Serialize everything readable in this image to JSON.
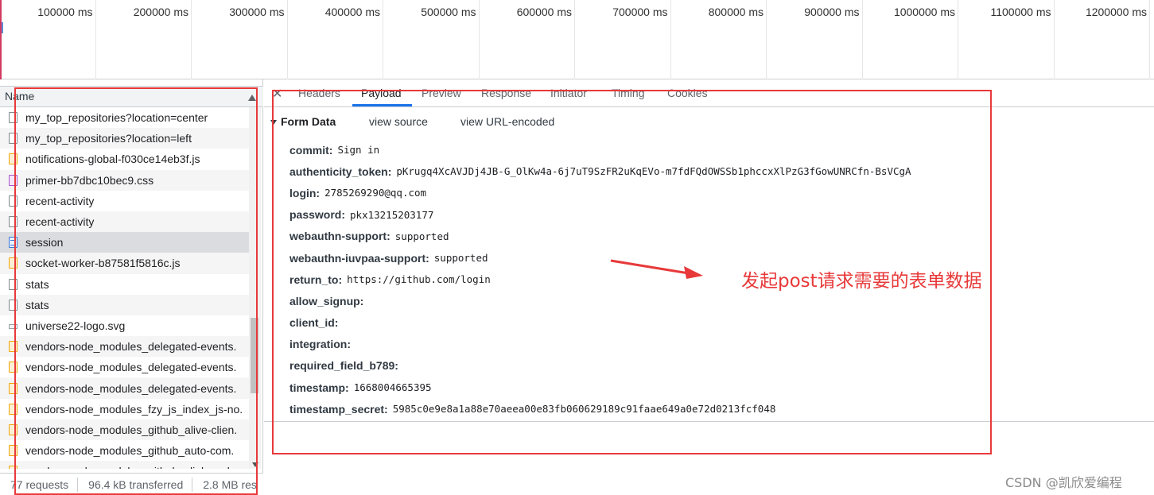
{
  "timeline": {
    "labels": [
      "100000 ms",
      "200000 ms",
      "300000 ms",
      "400000 ms",
      "500000 ms",
      "600000 ms",
      "700000 ms",
      "800000 ms",
      "900000 ms",
      "1000000 ms",
      "1100000 ms",
      "1200000 ms"
    ]
  },
  "requests": {
    "header": "Name",
    "items": [
      {
        "name": "my_top_repositories?location=center",
        "type": "doc-plain"
      },
      {
        "name": "my_top_repositories?location=left",
        "type": "doc-plain"
      },
      {
        "name": "notifications-global-f030ce14eb3f.js",
        "type": "js"
      },
      {
        "name": "primer-bb7dbc10bec9.css",
        "type": "css"
      },
      {
        "name": "recent-activity",
        "type": "doc-plain"
      },
      {
        "name": "recent-activity",
        "type": "doc-plain"
      },
      {
        "name": "session",
        "type": "doc",
        "selected": true
      },
      {
        "name": "socket-worker-b87581f5816c.js",
        "type": "js"
      },
      {
        "name": "stats",
        "type": "doc-plain"
      },
      {
        "name": "stats",
        "type": "doc-plain"
      },
      {
        "name": "universe22-logo.svg",
        "type": "img"
      },
      {
        "name": "vendors-node_modules_delegated-events.",
        "type": "js"
      },
      {
        "name": "vendors-node_modules_delegated-events.",
        "type": "js"
      },
      {
        "name": "vendors-node_modules_delegated-events.",
        "type": "js"
      },
      {
        "name": "vendors-node_modules_fzy_js_index_js-no.",
        "type": "js"
      },
      {
        "name": "vendors-node_modules_github_alive-clien.",
        "type": "js"
      },
      {
        "name": "vendors-node_modules_github_auto-com.",
        "type": "js"
      },
      {
        "name": "vendors-node_modules_github_clipboard",
        "type": "js"
      }
    ]
  },
  "status_bar": {
    "requests": "77 requests",
    "transferred": "96.4 kB transferred",
    "resources": "2.8 MB res"
  },
  "tabs": [
    {
      "label": "Headers"
    },
    {
      "label": "Payload",
      "active": true
    },
    {
      "label": "Preview"
    },
    {
      "label": "Response"
    },
    {
      "label": "Initiator"
    },
    {
      "label": "Timing"
    },
    {
      "label": "Cookies"
    }
  ],
  "form_data": {
    "title": "Form Data",
    "view_source": "view source",
    "view_url_encoded": "view URL-encoded",
    "fields": [
      {
        "key": "commit:",
        "value": "Sign in"
      },
      {
        "key": "authenticity_token:",
        "value": "pKrugq4XcAVJDj4JB-G_OlKw4a-6j7uT9SzFR2uKqEVo-m7fdFQdOWSSb1phccxXlPzG3fGowUNRCfn-BsVCgA"
      },
      {
        "key": "login:",
        "value": "2785269290@qq.com"
      },
      {
        "key": "password:",
        "value": "pkx13215203177"
      },
      {
        "key": "webauthn-support:",
        "value": "supported"
      },
      {
        "key": "webauthn-iuvpaa-support:",
        "value": "supported"
      },
      {
        "key": "return_to:",
        "value": "https://github.com/login"
      },
      {
        "key": "allow_signup:",
        "value": ""
      },
      {
        "key": "client_id:",
        "value": ""
      },
      {
        "key": "integration:",
        "value": ""
      },
      {
        "key": "required_field_b789:",
        "value": ""
      },
      {
        "key": "timestamp:",
        "value": "1668004665395"
      },
      {
        "key": "timestamp_secret:",
        "value": "5985c0e9e8a1a88e70aeea00e83fb060629189c91faae649a0e72d0213fcf048"
      }
    ]
  },
  "annotation": {
    "text": "发起post请求需要的表单数据",
    "color": "#e8393a"
  },
  "watermark": "CSDN @凯欣爱编程"
}
